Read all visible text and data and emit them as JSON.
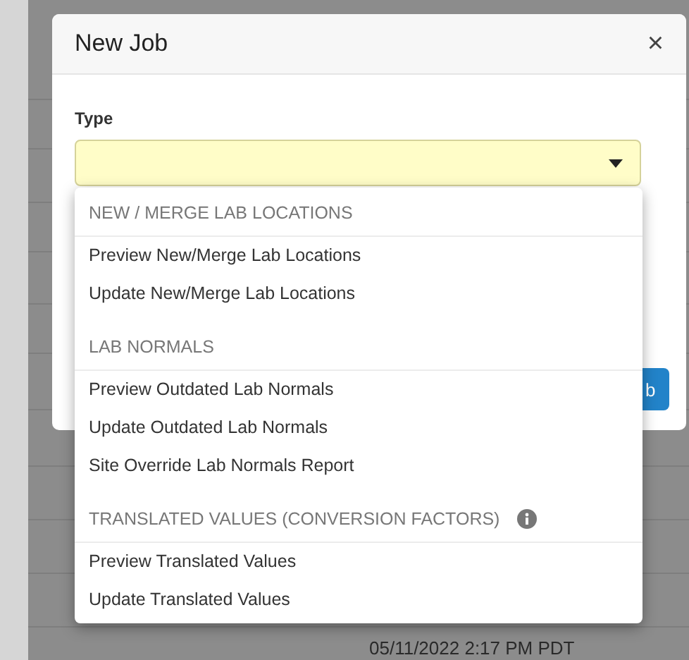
{
  "dialog": {
    "title": "New Job",
    "close": "×",
    "field_label": "Type",
    "hidden_button": "b"
  },
  "dropdown": {
    "groups": [
      {
        "header": "NEW / MERGE LAB LOCATIONS",
        "info": false,
        "items": [
          "Preview New/Merge Lab Locations",
          "Update New/Merge Lab Locations"
        ]
      },
      {
        "header": "LAB NORMALS",
        "info": false,
        "items": [
          "Preview Outdated Lab Normals",
          "Update Outdated Lab Normals",
          "Site Override Lab Normals Report"
        ]
      },
      {
        "header": "TRANSLATED VALUES (CONVERSION FACTORS)",
        "info": true,
        "items": [
          "Preview Translated Values",
          "Update Translated Values"
        ]
      }
    ]
  },
  "background": {
    "timestamp": "05/11/2022 2:17 PM PDT"
  }
}
